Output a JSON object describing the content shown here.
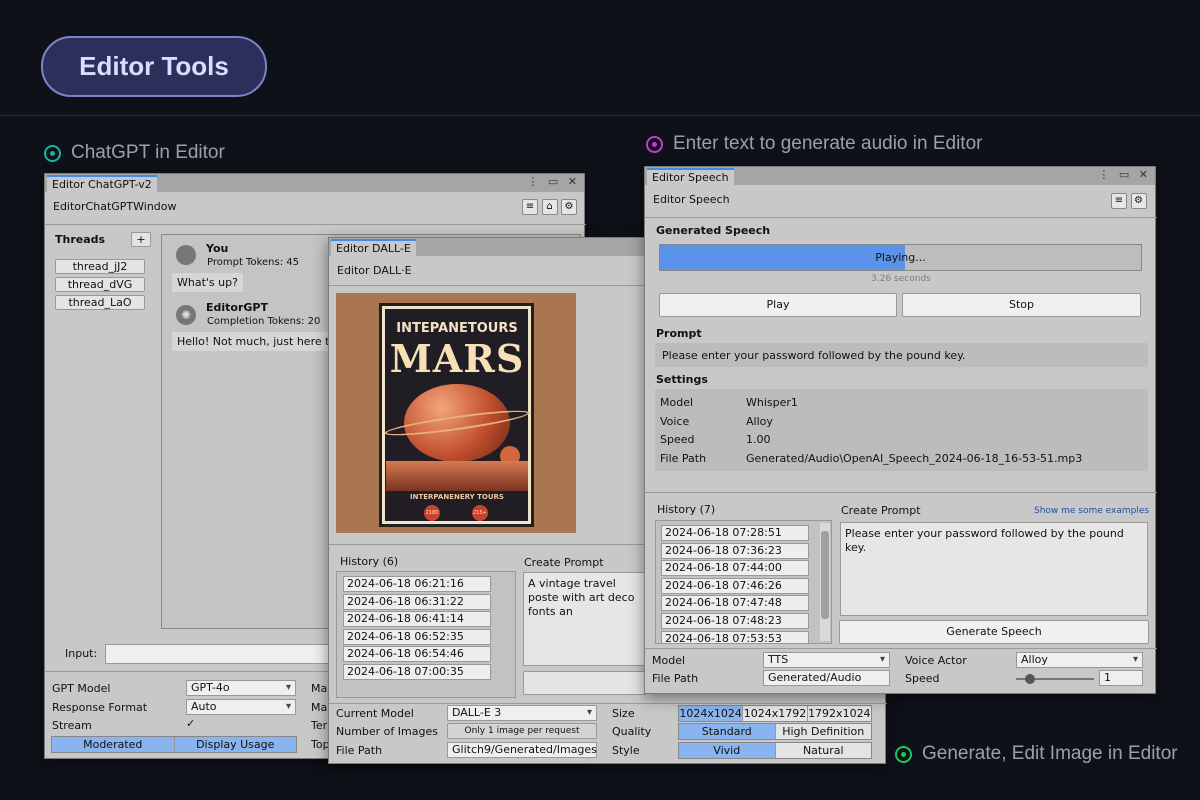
{
  "hero": {
    "title": "Editor Tools"
  },
  "captions": {
    "chatgpt": "ChatGPT in Editor",
    "speech": "Enter text to generate audio in Editor",
    "image": "Generate, Edit Image in Editor"
  },
  "colors": {
    "chat_accent": "#19b3a5",
    "speech_accent": "#c33ad6",
    "image_accent": "#22c55e",
    "selected": "#8ab4ef",
    "progress": "#5b93ea"
  },
  "chatgpt": {
    "tab": "Editor ChatGPT-v2",
    "header": "EditorChatGPTWindow",
    "threads_label": "Threads",
    "add_label": "+",
    "threads": [
      "thread_jJ2",
      "thread_dVG",
      "thread_LaO"
    ],
    "messages": [
      {
        "author": "You",
        "meta": "Prompt Tokens: 45",
        "text": "What's up?"
      },
      {
        "author": "EditorGPT",
        "meta": "Completion Tokens: 20",
        "text": "Hello! Not much, just here to"
      }
    ],
    "input_label": "Input:",
    "gpt_model_label": "GPT Model",
    "gpt_model": "GPT-4o",
    "response_format_label": "Response Format",
    "response_format": "Auto",
    "stream_label": "Stream",
    "stream_check": "✓",
    "seg": [
      "Moderated",
      "Display Usage"
    ],
    "right_labels": [
      "Ma",
      "Ma",
      "Ter",
      "Top"
    ]
  },
  "dalle": {
    "tab": "Editor DALL-E",
    "header": "Editor DALL·E",
    "poster": {
      "line1": "INTEPANETOURS",
      "line2": "MARS",
      "line3": "INTERPANENERY TOURS",
      "badge1": "2180",
      "badge2": "215+"
    },
    "history_label": "History (6)",
    "history": [
      "2024-06-18 06:21:16",
      "2024-06-18 06:31:22",
      "2024-06-18 06:41:14",
      "2024-06-18 06:52:35",
      "2024-06-18 06:54:46",
      "2024-06-18 07:00:35"
    ],
    "create_prompt_label": "Create Prompt",
    "prompt_text": "A vintage travel poste with art deco fonts an",
    "current_model_label": "Current Model",
    "current_model": "DALL-E 3",
    "num_images_label": "Number of Images",
    "num_images": "Only 1 image per request",
    "file_path_label": "File Path",
    "file_path": "Glitch9/Generated/Images",
    "size_label": "Size",
    "sizes": [
      "1024x1024",
      "1024x1792",
      "1792x1024"
    ],
    "quality_label": "Quality",
    "qualities": [
      "Standard",
      "High Definition"
    ],
    "style_label": "Style",
    "styles": [
      "Vivid",
      "Natural"
    ]
  },
  "speech": {
    "tab": "Editor Speech",
    "header": "Editor Speech",
    "generated_label": "Generated Speech",
    "status": "Playing...",
    "progress": 0.51,
    "duration": "3.26 seconds",
    "play": "Play",
    "stop": "Stop",
    "prompt_label": "Prompt",
    "prompt_text": "Please enter your password followed by the pound key.",
    "settings_label": "Settings",
    "settings": [
      {
        "k": "Model",
        "v": "Whisper1"
      },
      {
        "k": "Voice",
        "v": "Alloy"
      },
      {
        "k": "Speed",
        "v": "1.00"
      },
      {
        "k": "File Path",
        "v": "Generated/Audio\\OpenAI_Speech_2024-06-18_16-53-51.mp3"
      }
    ],
    "history_label": "History (7)",
    "history": [
      "2024-06-18 07:28:51",
      "2024-06-18 07:36:23",
      "2024-06-18 07:44:00",
      "2024-06-18 07:46:26",
      "2024-06-18 07:47:48",
      "2024-06-18 07:48:23",
      "2024-06-18 07:53:53"
    ],
    "create_prompt_label": "Create Prompt",
    "examples_link": "Show me some examples",
    "create_prompt_text": "Please enter your password followed by the pound key.",
    "generate": "Generate Speech",
    "model_label": "Model",
    "model": "TTS",
    "file_path_label": "File Path",
    "file_path": "Generated/Audio",
    "voice_actor_label": "Voice Actor",
    "voice_actor": "Alloy",
    "speed_label": "Speed",
    "speed": "1",
    "speed_fraction": 0.18
  }
}
